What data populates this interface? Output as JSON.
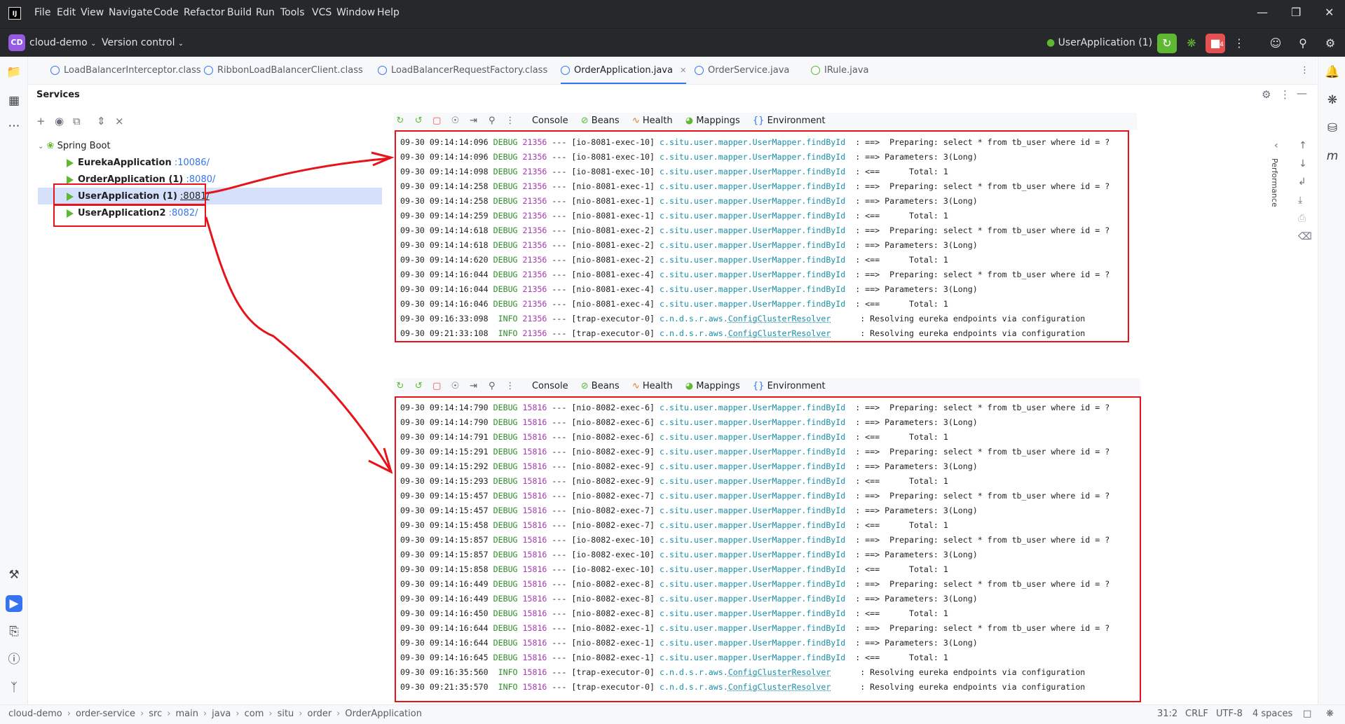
{
  "titlebar": {
    "menus": [
      "File",
      "Edit",
      "View",
      "Navigate",
      "Code",
      "Refactor",
      "Build",
      "Run",
      "Tools",
      "VCS",
      "Window",
      "Help"
    ]
  },
  "toolbar": {
    "project_badge": "CD",
    "project_name": "cloud-demo",
    "vcs": "Version control",
    "run_config": "UserApplication (1)",
    "notification_count": "4"
  },
  "tabs": [
    {
      "label": "LoadBalancerInterceptor.class"
    },
    {
      "label": "RibbonLoadBalancerClient.class"
    },
    {
      "label": "LoadBalancerRequestFactory.class"
    },
    {
      "label": "OrderApplication.java"
    },
    {
      "label": "OrderService.java"
    },
    {
      "label": "IRule.java"
    }
  ],
  "services": {
    "title": "Services",
    "root": "Spring Boot",
    "apps": [
      {
        "name": "EurekaApplication",
        "port": ":10086/"
      },
      {
        "name": "OrderApplication (1)",
        "port": ":8080/"
      },
      {
        "name": "UserApplication (1)",
        "port": ":8081/"
      },
      {
        "name": "UserApplication2",
        "port": ":8082/"
      }
    ]
  },
  "console_tabs": [
    "Console",
    "Beans",
    "Health",
    "Mappings",
    "Environment"
  ],
  "side_label": "Performance",
  "console1": {
    "lines": [
      [
        "09-30 09:14:14:096",
        "DEBUG",
        "21356",
        "---",
        "[io-8081-exec-10]",
        "c.situ.user.mapper.UserMapper.findById",
        "  : ==>  Preparing: select * from tb_user where id = ?"
      ],
      [
        "09-30 09:14:14:096",
        "DEBUG",
        "21356",
        "---",
        "[io-8081-exec-10]",
        "c.situ.user.mapper.UserMapper.findById",
        "  : ==> Parameters: 3(Long)"
      ],
      [
        "09-30 09:14:14:098",
        "DEBUG",
        "21356",
        "---",
        "[io-8081-exec-10]",
        "c.situ.user.mapper.UserMapper.findById",
        "  : <==      Total: 1"
      ],
      [
        "09-30 09:14:14:258",
        "DEBUG",
        "21356",
        "---",
        "[nio-8081-exec-1]",
        "c.situ.user.mapper.UserMapper.findById",
        "  : ==>  Preparing: select * from tb_user where id = ?"
      ],
      [
        "09-30 09:14:14:258",
        "DEBUG",
        "21356",
        "---",
        "[nio-8081-exec-1]",
        "c.situ.user.mapper.UserMapper.findById",
        "  : ==> Parameters: 3(Long)"
      ],
      [
        "09-30 09:14:14:259",
        "DEBUG",
        "21356",
        "---",
        "[nio-8081-exec-1]",
        "c.situ.user.mapper.UserMapper.findById",
        "  : <==      Total: 1"
      ],
      [
        "09-30 09:14:14:618",
        "DEBUG",
        "21356",
        "---",
        "[nio-8081-exec-2]",
        "c.situ.user.mapper.UserMapper.findById",
        "  : ==>  Preparing: select * from tb_user where id = ?"
      ],
      [
        "09-30 09:14:14:618",
        "DEBUG",
        "21356",
        "---",
        "[nio-8081-exec-2]",
        "c.situ.user.mapper.UserMapper.findById",
        "  : ==> Parameters: 3(Long)"
      ],
      [
        "09-30 09:14:14:620",
        "DEBUG",
        "21356",
        "---",
        "[nio-8081-exec-2]",
        "c.situ.user.mapper.UserMapper.findById",
        "  : <==      Total: 1"
      ],
      [
        "09-30 09:14:16:044",
        "DEBUG",
        "21356",
        "---",
        "[nio-8081-exec-4]",
        "c.situ.user.mapper.UserMapper.findById",
        "  : ==>  Preparing: select * from tb_user where id = ?"
      ],
      [
        "09-30 09:14:16:044",
        "DEBUG",
        "21356",
        "---",
        "[nio-8081-exec-4]",
        "c.situ.user.mapper.UserMapper.findById",
        "  : ==> Parameters: 3(Long)"
      ],
      [
        "09-30 09:14:16:046",
        "DEBUG",
        "21356",
        "---",
        "[nio-8081-exec-4]",
        "c.situ.user.mapper.UserMapper.findById",
        "  : <==      Total: 1"
      ],
      [
        "09-30 09:16:33:098",
        " INFO",
        "21356",
        "---",
        "[trap-executor-0]",
        "c.n.d.s.r.aws.ConfigClusterResolver",
        "      : Resolving eureka endpoints via configuration"
      ],
      [
        "09-30 09:21:33:108",
        " INFO",
        "21356",
        "---",
        "[trap-executor-0]",
        "c.n.d.s.r.aws.ConfigClusterResolver",
        "      : Resolving eureka endpoints via configuration"
      ]
    ]
  },
  "console2": {
    "lines": [
      [
        "09-30 09:14:14:790",
        "DEBUG",
        "15816",
        "---",
        "[nio-8082-exec-6]",
        "c.situ.user.mapper.UserMapper.findById",
        "  : ==>  Preparing: select * from tb_user where id = ?"
      ],
      [
        "09-30 09:14:14:790",
        "DEBUG",
        "15816",
        "---",
        "[nio-8082-exec-6]",
        "c.situ.user.mapper.UserMapper.findById",
        "  : ==> Parameters: 3(Long)"
      ],
      [
        "09-30 09:14:14:791",
        "DEBUG",
        "15816",
        "---",
        "[nio-8082-exec-6]",
        "c.situ.user.mapper.UserMapper.findById",
        "  : <==      Total: 1"
      ],
      [
        "09-30 09:14:15:291",
        "DEBUG",
        "15816",
        "---",
        "[nio-8082-exec-9]",
        "c.situ.user.mapper.UserMapper.findById",
        "  : ==>  Preparing: select * from tb_user where id = ?"
      ],
      [
        "09-30 09:14:15:292",
        "DEBUG",
        "15816",
        "---",
        "[nio-8082-exec-9]",
        "c.situ.user.mapper.UserMapper.findById",
        "  : ==> Parameters: 3(Long)"
      ],
      [
        "09-30 09:14:15:293",
        "DEBUG",
        "15816",
        "---",
        "[nio-8082-exec-9]",
        "c.situ.user.mapper.UserMapper.findById",
        "  : <==      Total: 1"
      ],
      [
        "09-30 09:14:15:457",
        "DEBUG",
        "15816",
        "---",
        "[nio-8082-exec-7]",
        "c.situ.user.mapper.UserMapper.findById",
        "  : ==>  Preparing: select * from tb_user where id = ?"
      ],
      [
        "09-30 09:14:15:457",
        "DEBUG",
        "15816",
        "---",
        "[nio-8082-exec-7]",
        "c.situ.user.mapper.UserMapper.findById",
        "  : ==> Parameters: 3(Long)"
      ],
      [
        "09-30 09:14:15:458",
        "DEBUG",
        "15816",
        "---",
        "[nio-8082-exec-7]",
        "c.situ.user.mapper.UserMapper.findById",
        "  : <==      Total: 1"
      ],
      [
        "09-30 09:14:15:857",
        "DEBUG",
        "15816",
        "---",
        "[io-8082-exec-10]",
        "c.situ.user.mapper.UserMapper.findById",
        "  : ==>  Preparing: select * from tb_user where id = ?"
      ],
      [
        "09-30 09:14:15:857",
        "DEBUG",
        "15816",
        "---",
        "[io-8082-exec-10]",
        "c.situ.user.mapper.UserMapper.findById",
        "  : ==> Parameters: 3(Long)"
      ],
      [
        "09-30 09:14:15:858",
        "DEBUG",
        "15816",
        "---",
        "[io-8082-exec-10]",
        "c.situ.user.mapper.UserMapper.findById",
        "  : <==      Total: 1"
      ],
      [
        "09-30 09:14:16:449",
        "DEBUG",
        "15816",
        "---",
        "[nio-8082-exec-8]",
        "c.situ.user.mapper.UserMapper.findById",
        "  : ==>  Preparing: select * from tb_user where id = ?"
      ],
      [
        "09-30 09:14:16:449",
        "DEBUG",
        "15816",
        "---",
        "[nio-8082-exec-8]",
        "c.situ.user.mapper.UserMapper.findById",
        "  : ==> Parameters: 3(Long)"
      ],
      [
        "09-30 09:14:16:450",
        "DEBUG",
        "15816",
        "---",
        "[nio-8082-exec-8]",
        "c.situ.user.mapper.UserMapper.findById",
        "  : <==      Total: 1"
      ],
      [
        "09-30 09:14:16:644",
        "DEBUG",
        "15816",
        "---",
        "[nio-8082-exec-1]",
        "c.situ.user.mapper.UserMapper.findById",
        "  : ==>  Preparing: select * from tb_user where id = ?"
      ],
      [
        "09-30 09:14:16:644",
        "DEBUG",
        "15816",
        "---",
        "[nio-8082-exec-1]",
        "c.situ.user.mapper.UserMapper.findById",
        "  : ==> Parameters: 3(Long)"
      ],
      [
        "09-30 09:14:16:645",
        "DEBUG",
        "15816",
        "---",
        "[nio-8082-exec-1]",
        "c.situ.user.mapper.UserMapper.findById",
        "  : <==      Total: 1"
      ],
      [
        "09-30 09:16:35:560",
        " INFO",
        "15816",
        "---",
        "[trap-executor-0]",
        "c.n.d.s.r.aws.ConfigClusterResolver",
        "      : Resolving eureka endpoints via configuration"
      ],
      [
        "09-30 09:21:35:570",
        " INFO",
        "15816",
        "---",
        "[trap-executor-0]",
        "c.n.d.s.r.aws.ConfigClusterResolver",
        "      : Resolving eureka endpoints via configuration"
      ]
    ]
  },
  "statusbar": {
    "breadcrumbs": [
      "cloud-demo",
      "order-service",
      "src",
      "main",
      "java",
      "com",
      "situ",
      "order",
      "OrderApplication"
    ],
    "position": "31:2",
    "line_sep": "CRLF",
    "encoding": "UTF-8",
    "indent": "4 spaces"
  },
  "colors": {
    "accent": "#3574f0",
    "annotation_red": "#e8121a",
    "run_green": "#5fb832"
  }
}
